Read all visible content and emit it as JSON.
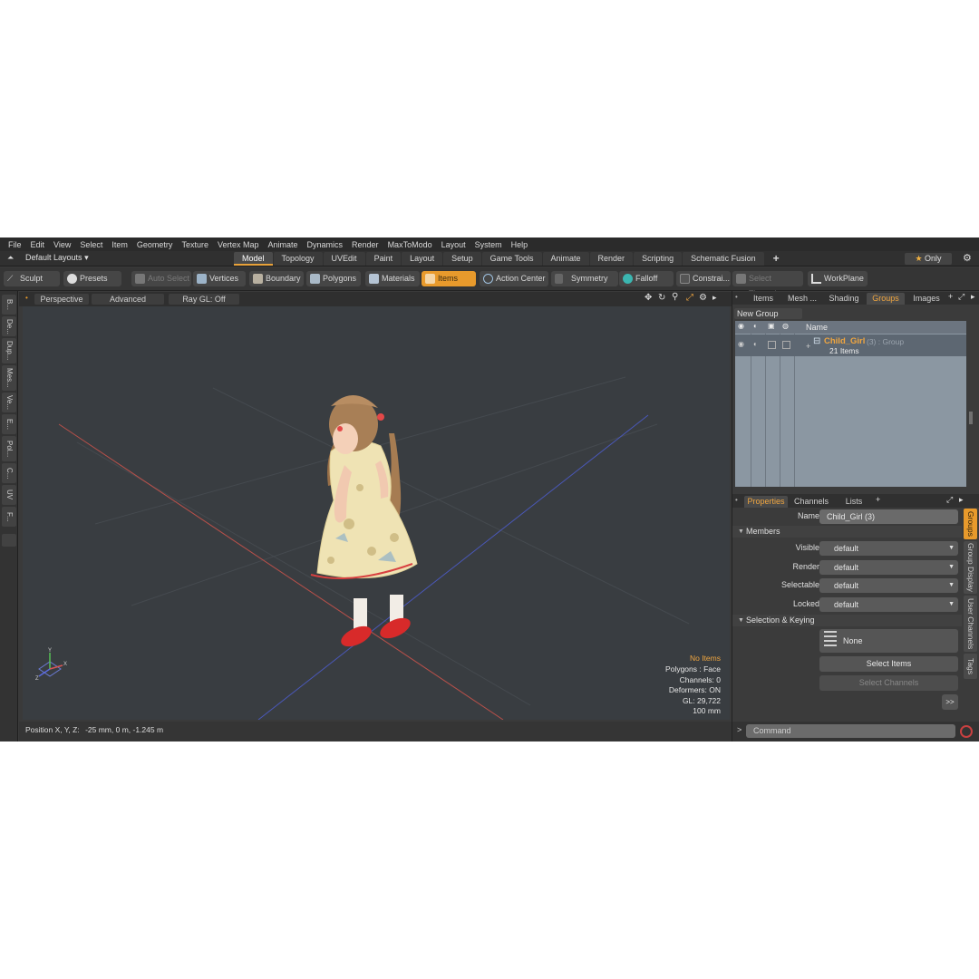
{
  "menubar": [
    "File",
    "Edit",
    "View",
    "Select",
    "Item",
    "Geometry",
    "Texture",
    "Vertex Map",
    "Animate",
    "Dynamics",
    "Render",
    "MaxToModo",
    "Layout",
    "System",
    "Help"
  ],
  "layouts": {
    "selector": "Default Layouts",
    "tabs": [
      "Model",
      "Topology",
      "UVEdit",
      "Paint",
      "Layout",
      "Setup",
      "Game Tools",
      "Animate",
      "Render",
      "Scripting",
      "Schematic Fusion"
    ],
    "active": "Model",
    "add": "+",
    "only": "Only"
  },
  "toolbar": {
    "sculpt": "Sculpt",
    "presets": "Presets",
    "auto_select": "Auto Select",
    "vertices": "Vertices",
    "boundary": "Boundary",
    "polygons": "Polygons",
    "materials": "Materials",
    "items": "Items",
    "action_center": "Action Center",
    "symmetry": "Symmetry",
    "falloff": "Falloff",
    "constraints": "Constrai...",
    "select_through": "Select Through",
    "workplane": "WorkPlane"
  },
  "left_tabs": [
    "B...",
    "De...",
    "Dup...",
    "Mes...",
    "Ve...",
    "E...",
    "Pol...",
    "C...",
    "UV",
    "F..."
  ],
  "viewport": {
    "view": "Perspective",
    "advanced": "Advanced",
    "raygl": "Ray GL: Off",
    "hud": {
      "items": "No Items",
      "polygons": "Polygons : Face",
      "channels": "Channels: 0",
      "deformers": "Deformers: ON",
      "gl": "GL: 29,722",
      "scale": "100 mm"
    },
    "axis": {
      "x": "X",
      "y": "Y",
      "z": "Z"
    }
  },
  "status": {
    "position_label": "Position X, Y, Z:",
    "position_value": "-25 mm, 0 m, -1.245 m"
  },
  "groups_panel": {
    "tabs": [
      "Items",
      "Mesh ...",
      "Shading",
      "Groups",
      "Images"
    ],
    "active": "Groups",
    "new_group": "New Group",
    "column_name": "Name",
    "group": {
      "name": "Child_Girl",
      "info": "(3) : Group",
      "count": "21 Items"
    }
  },
  "properties": {
    "tabs": [
      "Properties",
      "Channels",
      "Lists"
    ],
    "active": "Properties",
    "name_label": "Name",
    "name_value": "Child_Girl (3)",
    "members_section": "Members",
    "fields": [
      {
        "label": "Visible",
        "value": "default"
      },
      {
        "label": "Render",
        "value": "default"
      },
      {
        "label": "Selectable",
        "value": "default"
      },
      {
        "label": "Locked",
        "value": "default"
      }
    ],
    "selection_section": "Selection & Keying",
    "none_label": "None",
    "select_items": "Select Items",
    "select_channels": "Select Channels",
    "more": ">>"
  },
  "side_tabs": [
    "Groups",
    "Group Display",
    "User Channels",
    "Tags"
  ],
  "command": {
    "placeholder": "Command",
    "prompt": ">"
  },
  "colors": {
    "accent": "#e89a2c",
    "viewport_bg": "#393d41",
    "hud_highlight": "#f0a640"
  }
}
